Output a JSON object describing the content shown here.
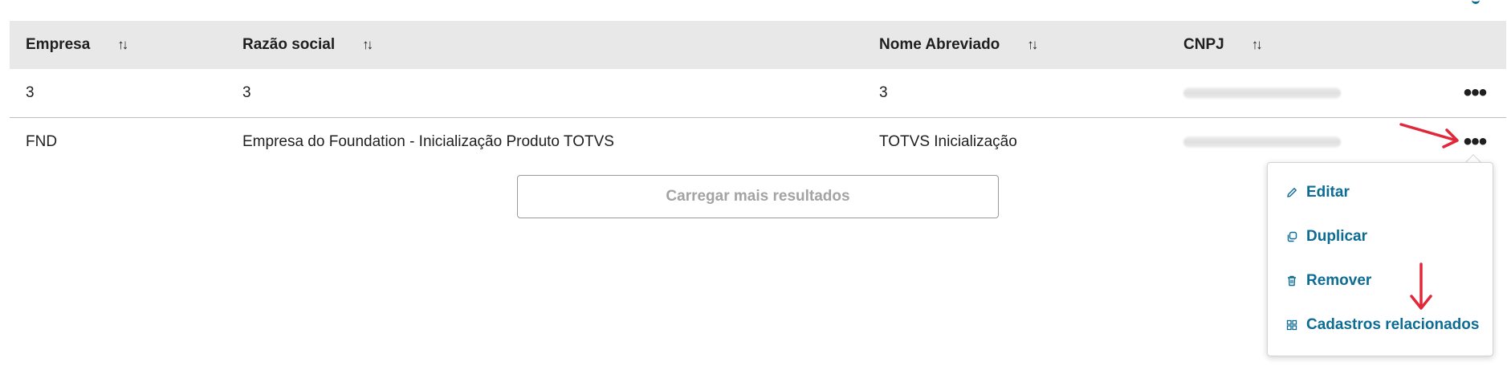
{
  "table": {
    "columns": [
      {
        "label": "Empresa",
        "sort_icon": "↑↓"
      },
      {
        "label": "Razão social",
        "sort_icon": "↑↓"
      },
      {
        "label": "Nome Abreviado",
        "sort_icon": "↑↓"
      },
      {
        "label": "CNPJ",
        "sort_icon": "↑↓"
      }
    ],
    "rows": [
      {
        "empresa": "3",
        "razao_social": "3",
        "nome_abreviado": "3",
        "cnpj": "redacted",
        "actions": "•••"
      },
      {
        "empresa": "FND",
        "razao_social": "Empresa do Foundation - Inicialização Produto TOTVS",
        "nome_abreviado": "TOTVS Inicialização",
        "cnpj": "redacted",
        "actions": "•••"
      }
    ]
  },
  "load_more_label": "Carregar mais resultados",
  "menu": {
    "items": [
      {
        "label": "Editar",
        "icon": "pencil-icon"
      },
      {
        "label": "Duplicar",
        "icon": "duplicate-icon"
      },
      {
        "label": "Remover",
        "icon": "trash-icon"
      },
      {
        "label": "Cadastros relacionados",
        "icon": "grid-icon"
      }
    ]
  },
  "colors": {
    "link": "#0c6c94",
    "header_bg": "#e8e8e8",
    "annotation_arrow": "#e0283a"
  }
}
